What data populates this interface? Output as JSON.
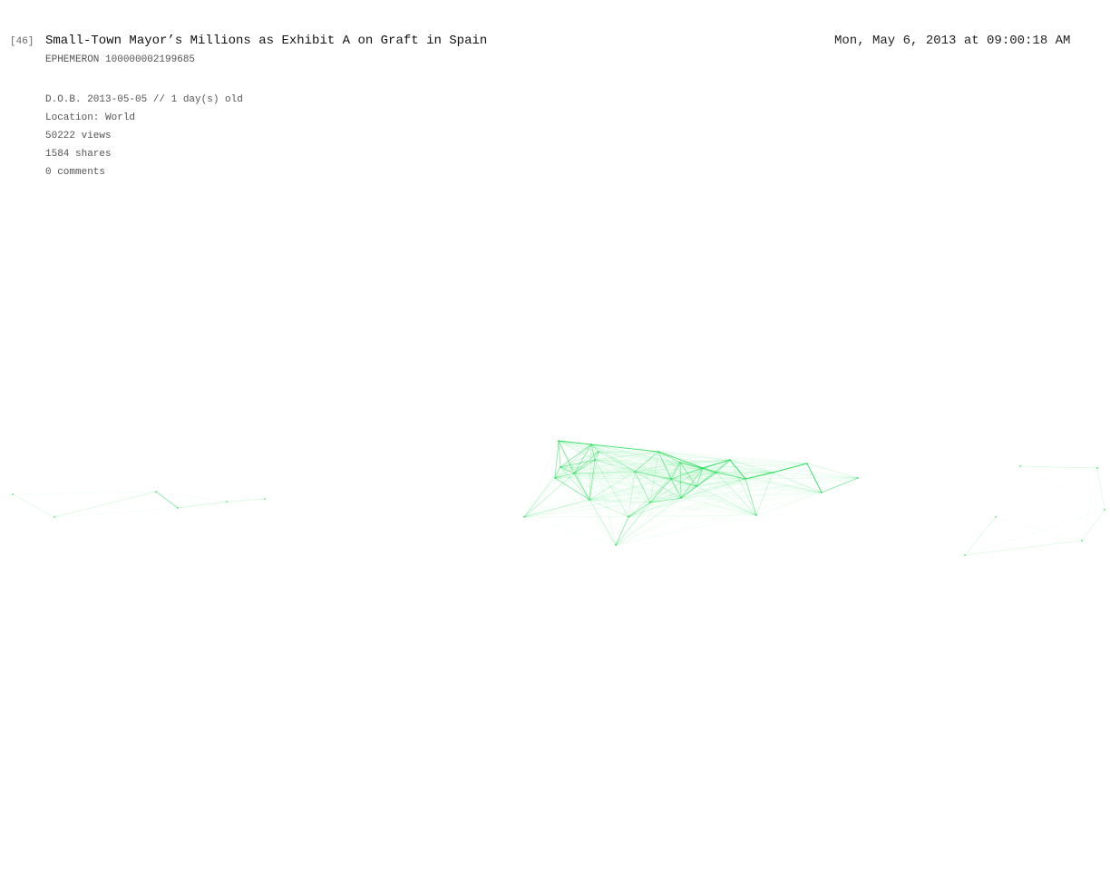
{
  "header": {
    "index": "[46]",
    "title": "Small-Town Mayor’s Millions as Exhibit A on Graft in Spain",
    "timestamp": "Mon, May 6, 2013 at 09:00:18 AM",
    "ephemeron_id": "EPHEMERON 100000002199685"
  },
  "stats": {
    "dob": "D.O.B. 2013-05-05  //  1 day(s) old",
    "location": "Location: World",
    "views": "50222 views",
    "shares": "1584 shares",
    "comments": "0 comments"
  },
  "visualization": {
    "stroke_color": "#22dd55"
  }
}
